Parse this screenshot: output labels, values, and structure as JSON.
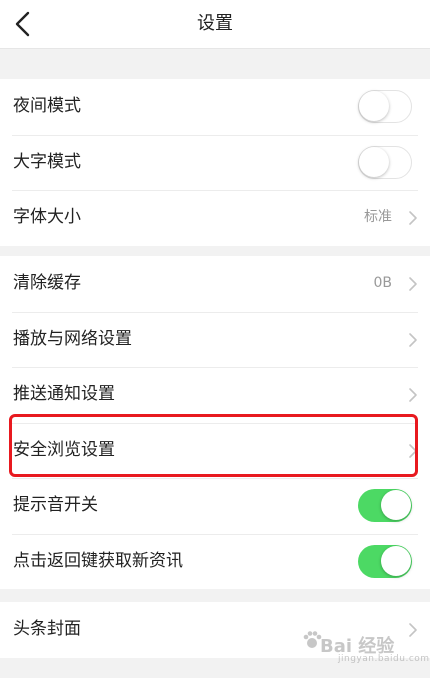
{
  "header": {
    "title": "设置"
  },
  "groups": [
    {
      "rows": [
        {
          "label": "夜间模式",
          "control": "toggle",
          "on": false
        },
        {
          "label": "大字模式",
          "control": "toggle",
          "on": false
        },
        {
          "label": "字体大小",
          "control": "chevron",
          "value": "标准"
        }
      ]
    },
    {
      "rows": [
        {
          "label": "清除缓存",
          "control": "chevron",
          "value": "0B"
        },
        {
          "label": "播放与网络设置",
          "control": "chevron"
        },
        {
          "label": "推送通知设置",
          "control": "chevron"
        },
        {
          "label": "安全浏览设置",
          "control": "chevron"
        },
        {
          "label": "提示音开关",
          "control": "toggle",
          "on": true
        },
        {
          "label": "点击返回键获取新资讯",
          "control": "toggle",
          "on": true
        }
      ]
    },
    {
      "rows": [
        {
          "label": "头条封面",
          "control": "chevron"
        }
      ]
    }
  ],
  "watermark": {
    "brand": "Bai 经验",
    "sub": "jingyan.baidu.com"
  },
  "colors": {
    "toggle_on": "#4cd964",
    "highlight": "#e8191f",
    "background": "#f2f2f2"
  }
}
